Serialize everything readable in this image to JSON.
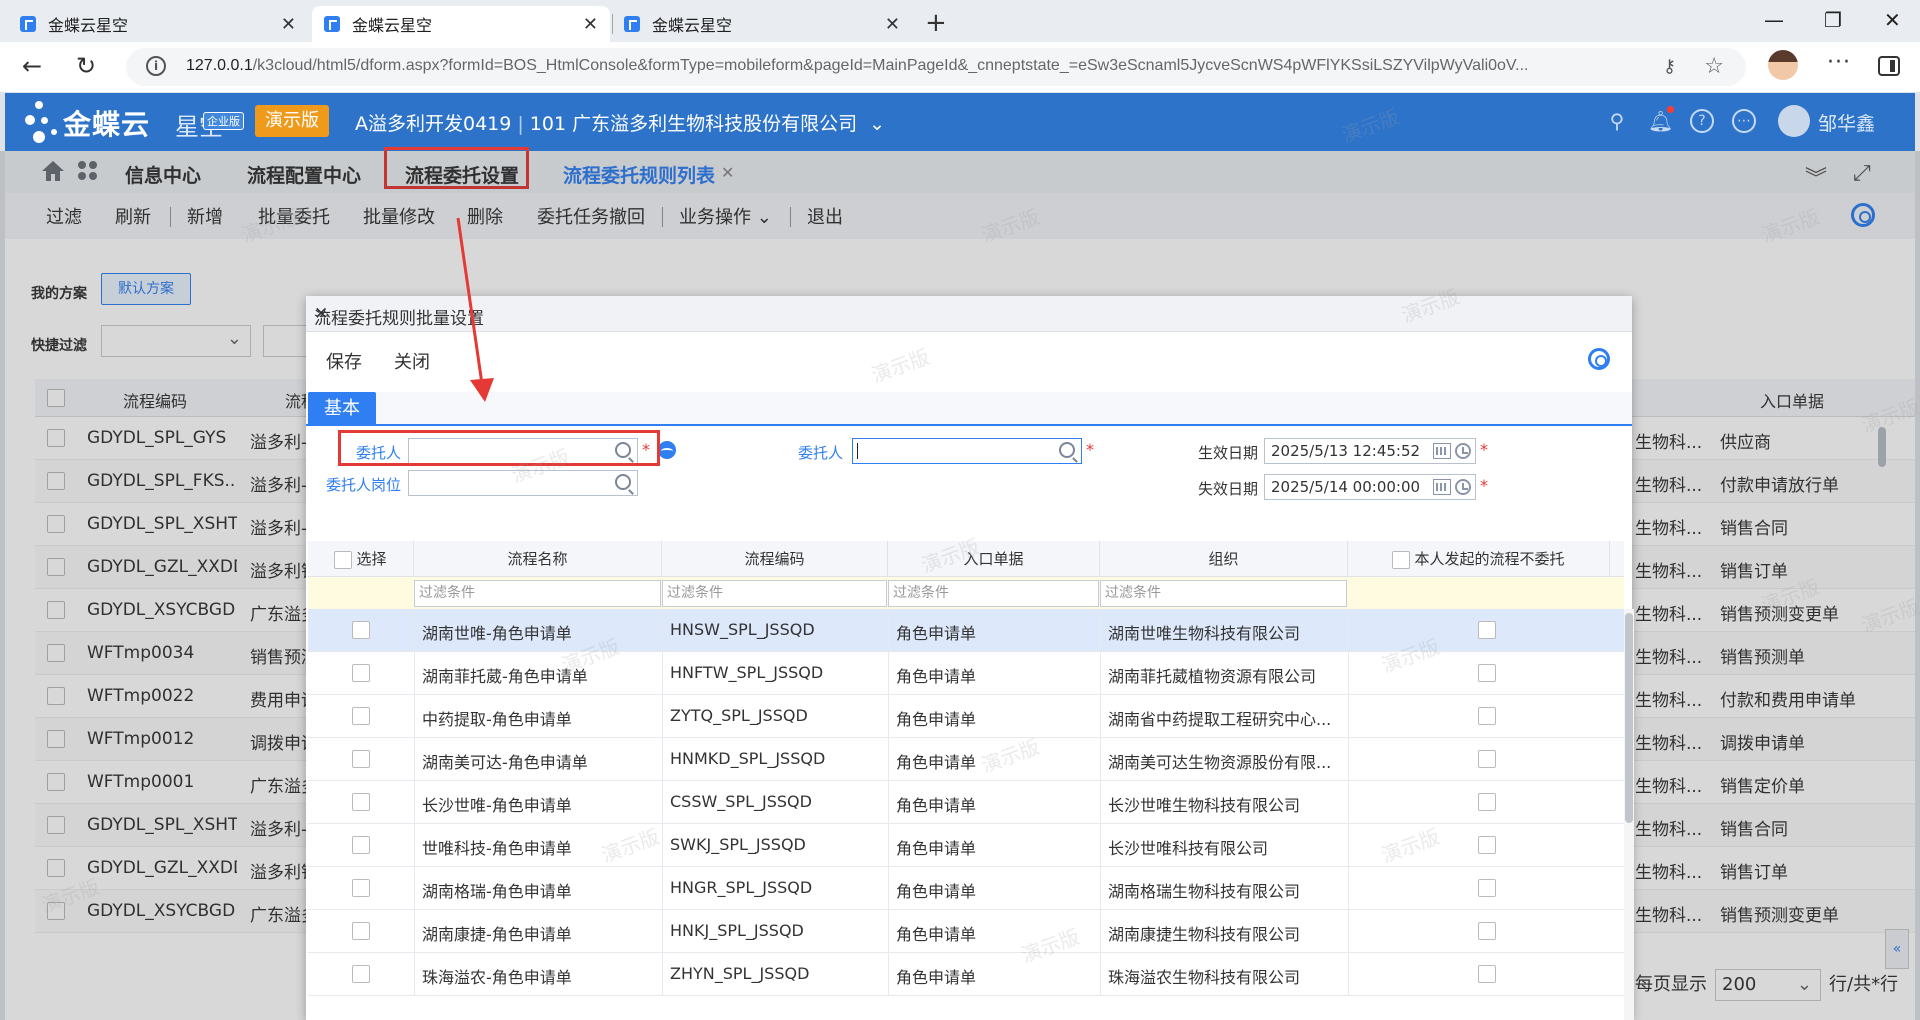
{
  "browser": {
    "tabs": [
      {
        "title": "金蝶云星空"
      },
      {
        "title": "金蝶云星空"
      },
      {
        "title": "金蝶云星空"
      }
    ],
    "url_main": "127.0.0.1",
    "url_rest": "/k3cloud/html5/dform.aspx?formId=BOS_HtmlConsole&formType=mobileform&pageId=MainPageId&_cnneptstate_=eSw3eScnaml5JycveScnWS4pWFlYKSsiLSZYVilpWyVali0oV..."
  },
  "app": {
    "logo": "金蝶云",
    "logo_sub": "星空",
    "edition": "企业版",
    "demo": "演示版",
    "account": "A溢多利开发0419",
    "org": "101 广东溢多利生物科技股份有限公司",
    "user": "邹华鑫"
  },
  "app_tabs": [
    "信息中心",
    "流程配置中心",
    "流程委托设置",
    "流程委托规则列表"
  ],
  "toolbar": [
    "过滤",
    "刷新",
    "新增",
    "批量委托",
    "批量修改",
    "删除",
    "委托任务撤回",
    "业务操作",
    "退出"
  ],
  "bg": {
    "scheme_label": "我的方案",
    "scheme_btn": "默认方案",
    "quick_filter": "快捷过滤",
    "col_code": "流程编码",
    "col_name": "流程",
    "col_entry": "入口单据",
    "rows": [
      {
        "code": "GDYDL_SPL_GYS",
        "name": "溢多利-",
        "org": "生物科...",
        "entry": "供应商"
      },
      {
        "code": "GDYDL_SPL_FKS...",
        "name": "溢多利-",
        "org": "生物科...",
        "entry": "付款申请放行单"
      },
      {
        "code": "GDYDL_SPL_XSHT",
        "name": "溢多利-",
        "org": "生物科...",
        "entry": "销售合同"
      },
      {
        "code": "GDYDL_GZL_XXDD",
        "name": "溢多利销",
        "org": "生物科...",
        "entry": "销售订单"
      },
      {
        "code": "GDYDL_XSYCBGD",
        "name": "广东溢多",
        "org": "生物科...",
        "entry": "销售预测变更单"
      },
      {
        "code": "WFTmp0034",
        "name": "销售预测",
        "org": "生物科...",
        "entry": "销售预测单"
      },
      {
        "code": "WFTmp0022",
        "name": "费用申请",
        "org": "生物科...",
        "entry": "付款和费用申请单"
      },
      {
        "code": "WFTmp0012",
        "name": "调拨申请",
        "org": "生物科...",
        "entry": "调拨申请单"
      },
      {
        "code": "WFTmp0001",
        "name": "广东溢多",
        "org": "生物科...",
        "entry": "销售定价单"
      },
      {
        "code": "GDYDL_SPL_XSHT",
        "name": "溢多利-",
        "org": "生物科...",
        "entry": "销售合同"
      },
      {
        "code": "GDYDL_GZL_XXDD",
        "name": "溢多利销",
        "org": "生物科...",
        "entry": "销售订单"
      },
      {
        "code": "GDYDL_XSYCBGD",
        "name": "广东溢多",
        "org": "生物科...",
        "entry": "销售预测变更单"
      }
    ],
    "pager_label": "每页显示",
    "pager_value": "200",
    "pager_suffix": "行/共*行"
  },
  "modal": {
    "title": "流程委托规则批量设置",
    "save": "保存",
    "close": "关闭",
    "tab": "基本",
    "labels": {
      "delegator": "委托人",
      "delegator_post": "委托人岗位",
      "delegatee": "委托人",
      "start": "生效日期",
      "end": "失效日期"
    },
    "start_date": "2025/5/13 12:45:52",
    "end_date": "2025/5/14 00:00:00",
    "req": "*",
    "columns": [
      "选择",
      "流程名称",
      "流程编码",
      "入口单据",
      "组织",
      "本人发起的流程不委托"
    ],
    "filter_placeholder": "过滤条件",
    "rows": [
      {
        "name": "湖南世唯-角色申请单",
        "code": "HNSW_SPL_JSSQD",
        "entry": "角色申请单",
        "org": "湖南世唯生物科技有限公司"
      },
      {
        "name": "湖南菲托葳-角色申请单",
        "code": "HNFTW_SPL_JSSQD",
        "entry": "角色申请单",
        "org": "湖南菲托葳植物资源有限公司"
      },
      {
        "name": "中药提取-角色申请单",
        "code": "ZYTQ_SPL_JSSQD",
        "entry": "角色申请单",
        "org": "湖南省中药提取工程研究中心..."
      },
      {
        "name": "湖南美可达-角色申请单",
        "code": "HNMKD_SPL_JSSQD",
        "entry": "角色申请单",
        "org": "湖南美可达生物资源股份有限..."
      },
      {
        "name": "长沙世唯-角色申请单",
        "code": "CSSW_SPL_JSSQD",
        "entry": "角色申请单",
        "org": "长沙世唯生物科技有限公司"
      },
      {
        "name": "世唯科技-角色申请单",
        "code": "SWKJ_SPL_JSSQD",
        "entry": "角色申请单",
        "org": "长沙世唯科技有限公司"
      },
      {
        "name": "湖南格瑞-角色申请单",
        "code": "HNGR_SPL_JSSQD",
        "entry": "角色申请单",
        "org": "湖南格瑞生物科技有限公司"
      },
      {
        "name": "湖南康捷-角色申请单",
        "code": "HNKJ_SPL_JSSQD",
        "entry": "角色申请单",
        "org": "湖南康捷生物科技有限公司"
      },
      {
        "name": "珠海溢农-角色申请单",
        "code": "ZHYN_SPL_JSSQD",
        "entry": "角色申请单",
        "org": "珠海溢农生物科技有限公司"
      }
    ]
  },
  "watermark": "演示版",
  "colors": {
    "brand": "#2d73ca",
    "accent": "#2f7ff2",
    "highlight": "#e53935",
    "demo": "#f09a1c"
  }
}
